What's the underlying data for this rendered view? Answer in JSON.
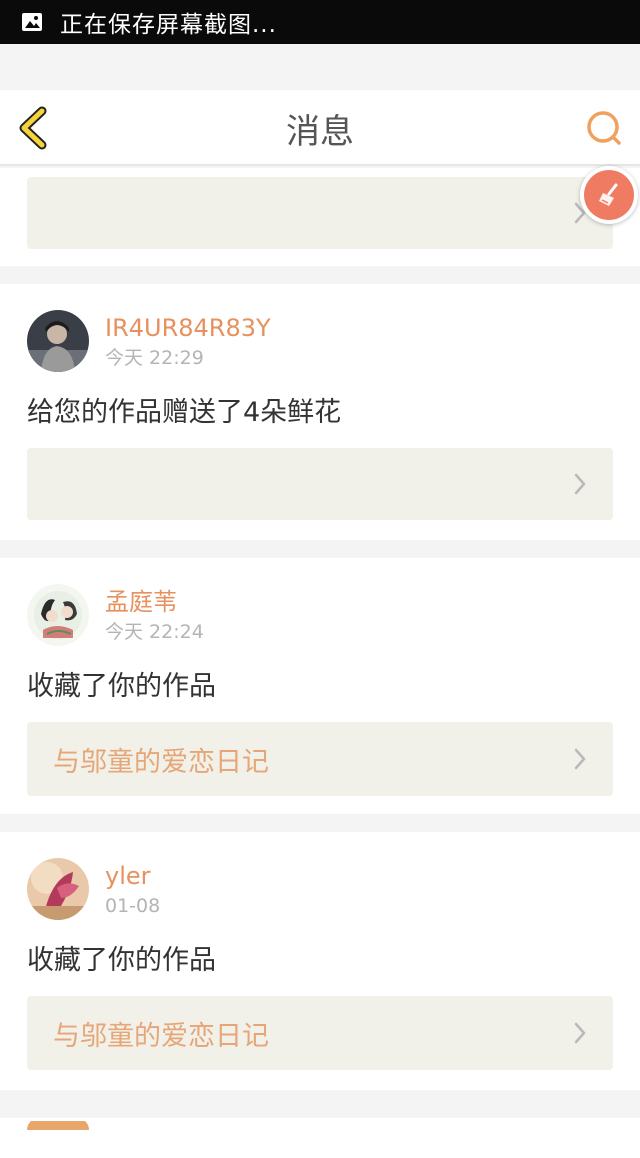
{
  "status_bar": {
    "icon": "image-icon",
    "text": "正在保存屏幕截图..."
  },
  "nav": {
    "back_icon": "chevron-left-icon",
    "title": "消息",
    "search_icon": "search-icon"
  },
  "floating_button": {
    "icon": "broom-icon"
  },
  "colors": {
    "accent": "#e6915e",
    "work_title": "#e6a677",
    "box_bg": "#f1f1ea",
    "time": "#b4b4b4"
  },
  "messages": [
    {
      "name": "IR4UR84R83Y",
      "time": "今天 22:29",
      "action": "给您的作品赠送了4朵鲜花",
      "work": ""
    },
    {
      "name": "孟庭苇",
      "time": "今天 22:24",
      "action": "收藏了你的作品",
      "work": "与邬童的爱恋日记"
    },
    {
      "name": "yler",
      "time": "01-08",
      "action": "收藏了你的作品",
      "work": "与邬童的爱恋日记"
    }
  ]
}
